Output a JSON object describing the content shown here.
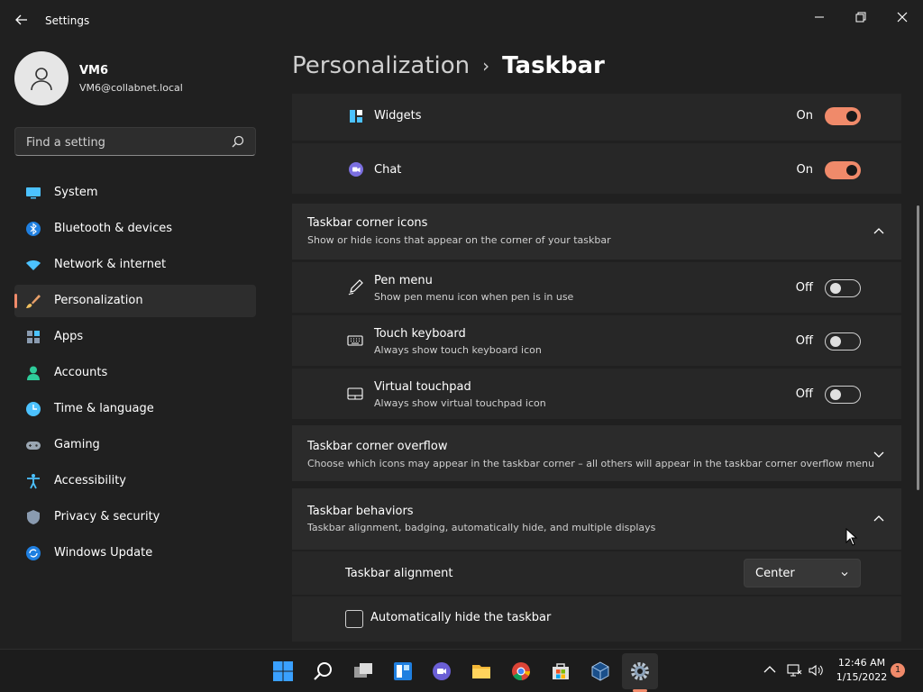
{
  "app": {
    "title": "Settings"
  },
  "window_controls": {
    "minimize": "—",
    "maximize": "❐",
    "close": "✕"
  },
  "profile": {
    "name": "VM6",
    "email": "VM6@collabnet.local"
  },
  "search": {
    "placeholder": "Find a setting"
  },
  "sidebar": {
    "items": [
      {
        "label": "System",
        "icon": "system-icon"
      },
      {
        "label": "Bluetooth & devices",
        "icon": "bluetooth-icon"
      },
      {
        "label": "Network & internet",
        "icon": "wifi-icon"
      },
      {
        "label": "Personalization",
        "icon": "brush-icon",
        "active": true
      },
      {
        "label": "Apps",
        "icon": "apps-icon"
      },
      {
        "label": "Accounts",
        "icon": "accounts-icon"
      },
      {
        "label": "Time & language",
        "icon": "clock-icon"
      },
      {
        "label": "Gaming",
        "icon": "gamepad-icon"
      },
      {
        "label": "Accessibility",
        "icon": "accessibility-icon"
      },
      {
        "label": "Privacy & security",
        "icon": "shield-icon"
      },
      {
        "label": "Windows Update",
        "icon": "update-icon"
      }
    ]
  },
  "breadcrumb": {
    "parent": "Personalization",
    "separator": "›",
    "current": "Taskbar"
  },
  "taskbar_items": {
    "widgets": {
      "label": "Widgets",
      "state": "On"
    },
    "chat": {
      "label": "Chat",
      "state": "On"
    }
  },
  "corner_icons": {
    "title": "Taskbar corner icons",
    "description": "Show or hide icons that appear on the corner of your taskbar",
    "items": [
      {
        "label": "Pen menu",
        "description": "Show pen menu icon when pen is in use",
        "state": "Off"
      },
      {
        "label": "Touch keyboard",
        "description": "Always show touch keyboard icon",
        "state": "Off"
      },
      {
        "label": "Virtual touchpad",
        "description": "Always show virtual touchpad icon",
        "state": "Off"
      }
    ]
  },
  "corner_overflow": {
    "title": "Taskbar corner overflow",
    "description": "Choose which icons may appear in the taskbar corner – all others will appear in the taskbar corner overflow menu"
  },
  "behaviors": {
    "title": "Taskbar behaviors",
    "description": "Taskbar alignment, badging, automatically hide, and multiple displays",
    "alignment_label": "Taskbar alignment",
    "alignment_value": "Center",
    "autohide_label": "Automatically hide the taskbar"
  },
  "system_tray": {
    "time": "12:46 AM",
    "date": "1/15/2022",
    "notification_count": "1"
  },
  "colors": {
    "accent": "#f08a6a",
    "background": "#202020",
    "card": "#2b2b2b"
  }
}
